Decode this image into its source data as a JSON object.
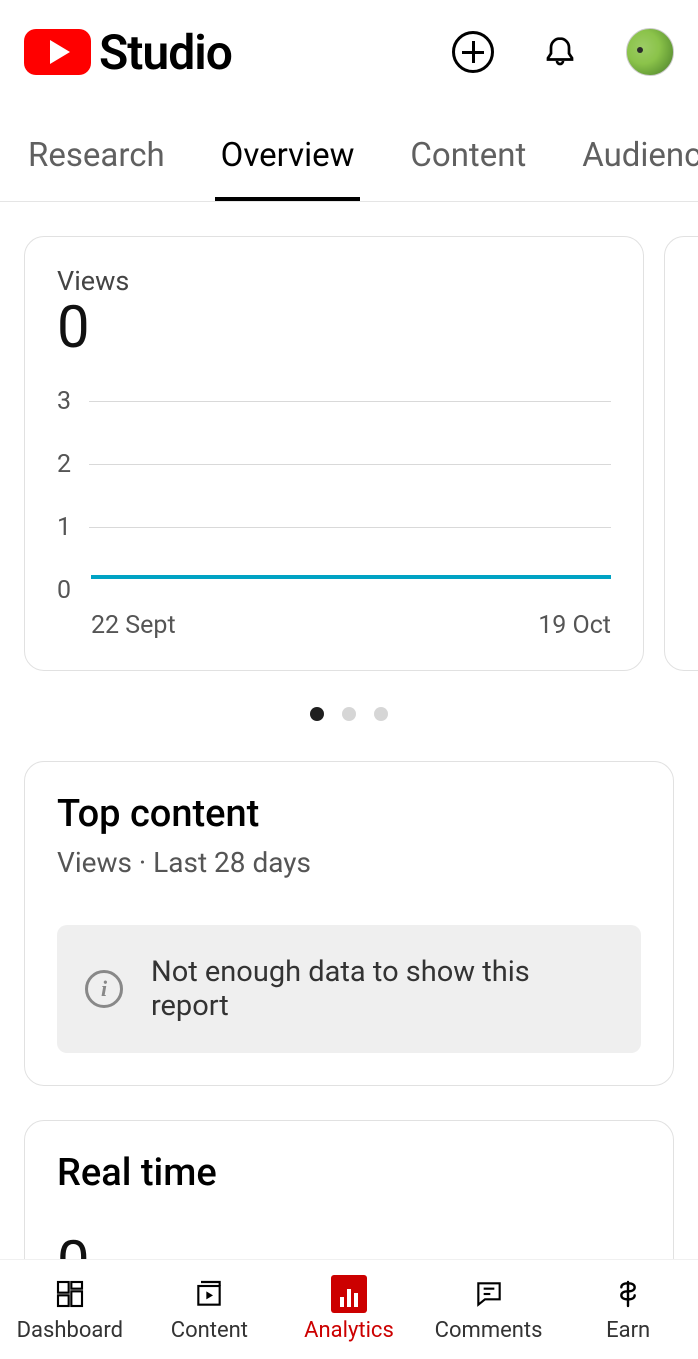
{
  "header": {
    "logo_text": "Studio"
  },
  "tabs": [
    {
      "id": "research",
      "label": "Research",
      "active": false
    },
    {
      "id": "overview",
      "label": "Overview",
      "active": true
    },
    {
      "id": "content",
      "label": "Content",
      "active": false
    },
    {
      "id": "audience",
      "label": "Audience",
      "active": false
    }
  ],
  "views_card": {
    "title": "Views",
    "value": "0"
  },
  "chart_data": {
    "type": "line",
    "title": "Views",
    "xlabel": "",
    "ylabel": "",
    "ylim": [
      0,
      3
    ],
    "y_ticks": [
      3,
      2,
      1,
      0
    ],
    "x_range": [
      "22 Sept",
      "19 Oct"
    ],
    "series": [
      {
        "name": "Views",
        "values_constant": 0
      }
    ]
  },
  "pager": {
    "count": 3,
    "active": 0
  },
  "top_content": {
    "title": "Top content",
    "subtitle": "Views · Last 28 days",
    "empty_message": "Not enough data to show this report"
  },
  "realtime": {
    "title": "Real time",
    "value": "0"
  },
  "bottom_nav": [
    {
      "id": "dashboard",
      "label": "Dashboard",
      "active": false
    },
    {
      "id": "content",
      "label": "Content",
      "active": false
    },
    {
      "id": "analytics",
      "label": "Analytics",
      "active": true
    },
    {
      "id": "comments",
      "label": "Comments",
      "active": false
    },
    {
      "id": "earn",
      "label": "Earn",
      "active": false
    }
  ]
}
